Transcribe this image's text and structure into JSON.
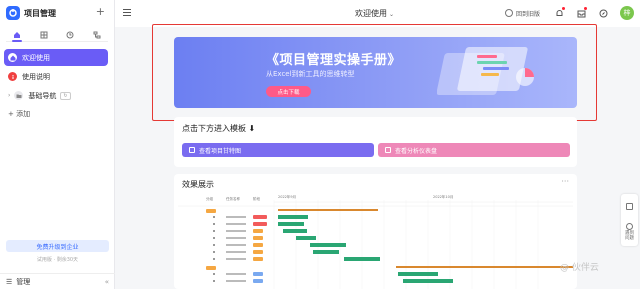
{
  "brand": {
    "name": "项目管理",
    "plus": "+"
  },
  "sidebar": {
    "tabs": [
      "home-icon",
      "grid-icon",
      "clock-icon",
      "sitemap-icon"
    ],
    "items": [
      {
        "label": "欢迎使用",
        "icon": "home-icon",
        "color": "#6a5cf6"
      },
      {
        "label": "使用说明",
        "icon": "info-icon",
        "color": "#f04040"
      },
      {
        "label": "基础导航",
        "icon": "folder-icon",
        "color": "#888888",
        "badge": "↻"
      }
    ],
    "add": "+ 添加",
    "upgrade": "免费升级到企业",
    "trial": "试用版 · 剩余30天",
    "footer": {
      "label": "管理",
      "collapse": "«"
    }
  },
  "topbar": {
    "title": "欢迎使用",
    "title_chevron": "⌄",
    "old_version": "回到旧版",
    "avatar": "梓"
  },
  "banner": {
    "title": "《项目管理实操手册》",
    "subtitle": "从Excel到新工具的思维转型",
    "button": "点击下载"
  },
  "templates": {
    "title": "点击下方进入模板",
    "arrow": "⬇",
    "buttons": [
      {
        "label": "查看项目甘特图",
        "color": "#7a6cf0"
      },
      {
        "label": "查看分析仪表盘",
        "color": "#ee88b8"
      }
    ]
  },
  "showcase": {
    "title": "效果展示",
    "more": "···",
    "gantt_months": [
      "2022年9月",
      "2022年10月"
    ],
    "gantt_columns": [
      "分组",
      "任务名称",
      "阶段"
    ]
  },
  "side_tools": [
    {
      "label": "遇到\n问题"
    }
  ],
  "watermark": "@ 伙伴云"
}
